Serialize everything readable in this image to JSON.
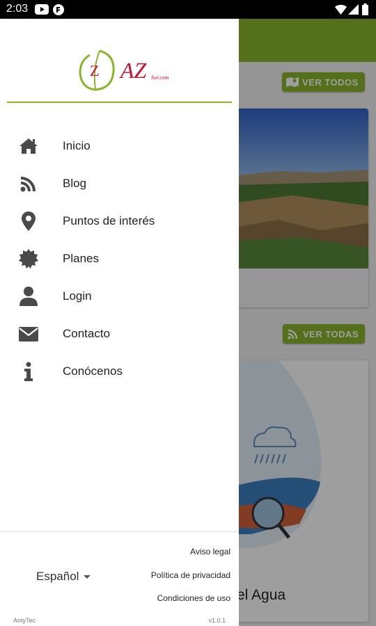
{
  "status_bar": {
    "time": "2:03"
  },
  "background": {
    "ver_todos_label": "VER TODOS",
    "ver_todas_label": "VER TODAS",
    "blog_card_title": "el Agua"
  },
  "drawer": {
    "logo_text": "AZ",
    "logo_subtext": "Sur.com",
    "menu": [
      {
        "label": "Inicio",
        "icon": "home-icon"
      },
      {
        "label": "Blog",
        "icon": "blog-icon"
      },
      {
        "label": "Puntos de interés",
        "icon": "location-pin-icon"
      },
      {
        "label": "Planes",
        "icon": "badge-icon"
      },
      {
        "label": "Login",
        "icon": "user-icon"
      },
      {
        "label": "Contacto",
        "icon": "envelope-icon"
      },
      {
        "label": "Conócenos",
        "icon": "info-icon"
      }
    ],
    "language": "Español",
    "legal": {
      "aviso": "Aviso legal",
      "privacidad": "Política de privacidad",
      "condiciones": "Condiciones de uso"
    },
    "credit": "AntyTec",
    "version": "v1.0.1"
  },
  "colors": {
    "accent": "#8ab52b",
    "logo_red": "#c8102e",
    "icon_gray": "#4a4a4a"
  }
}
